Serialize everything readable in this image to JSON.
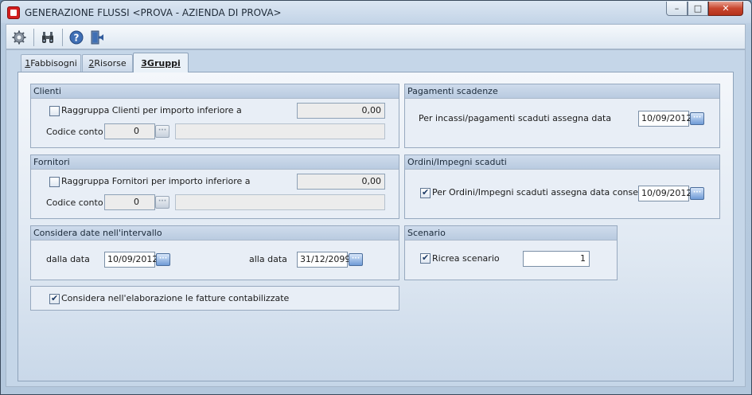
{
  "window": {
    "title": "GENERAZIONE FLUSSI <PROVA - AZIENDA DI PROVA>",
    "controls": {
      "minimize": "–",
      "maximize": "□",
      "close": "✕"
    }
  },
  "toolbar": {
    "icons": [
      "gear-icon",
      "binoculars-icon",
      "help-icon",
      "exit-door-icon"
    ]
  },
  "tabs": [
    {
      "key": "1",
      "rest": " Fabbisogni"
    },
    {
      "key": "2",
      "rest": " Risorse"
    },
    {
      "key": "3",
      "rest": " Gruppi"
    }
  ],
  "clienti": {
    "title": "Clienti",
    "raggruppa_label": "Raggruppa Clienti per importo inferiore a",
    "raggruppa_checked": false,
    "importo": "0,00",
    "codice_label": "Codice conto",
    "codice_value": "0",
    "descrizione": ""
  },
  "fornitori": {
    "title": "Fornitori",
    "raggruppa_label": "Raggruppa Fornitori per importo inferiore a",
    "raggruppa_checked": false,
    "importo": "0,00",
    "codice_label": "Codice conto",
    "codice_value": "0",
    "descrizione": ""
  },
  "intervallo": {
    "title": "Considera date nell'intervallo",
    "dalla_label": "dalla data",
    "dalla_value": "10/09/2012",
    "alla_label": "alla data",
    "alla_value": "31/12/2099"
  },
  "fatture": {
    "label": "Considera nell'elaborazione le fatture contabilizzate",
    "checked": true
  },
  "pagamenti": {
    "title": "Pagamenti scadenze",
    "label": "Per incassi/pagamenti scaduti assegna data",
    "value": "10/09/2012"
  },
  "ordini": {
    "title": "Ordini/Impegni scaduti",
    "label": "Per Ordini/Impegni scaduti assegna data consegna",
    "checked": true,
    "value": "10/09/2012"
  },
  "scenario": {
    "title": "Scenario",
    "label": "Ricrea scenario",
    "checked": true,
    "value": "1"
  },
  "ellipsis": "···",
  "colors": {
    "accent": "#3f6fb5",
    "close_button": "#c8462e",
    "group_header": "#bfd0e4"
  }
}
